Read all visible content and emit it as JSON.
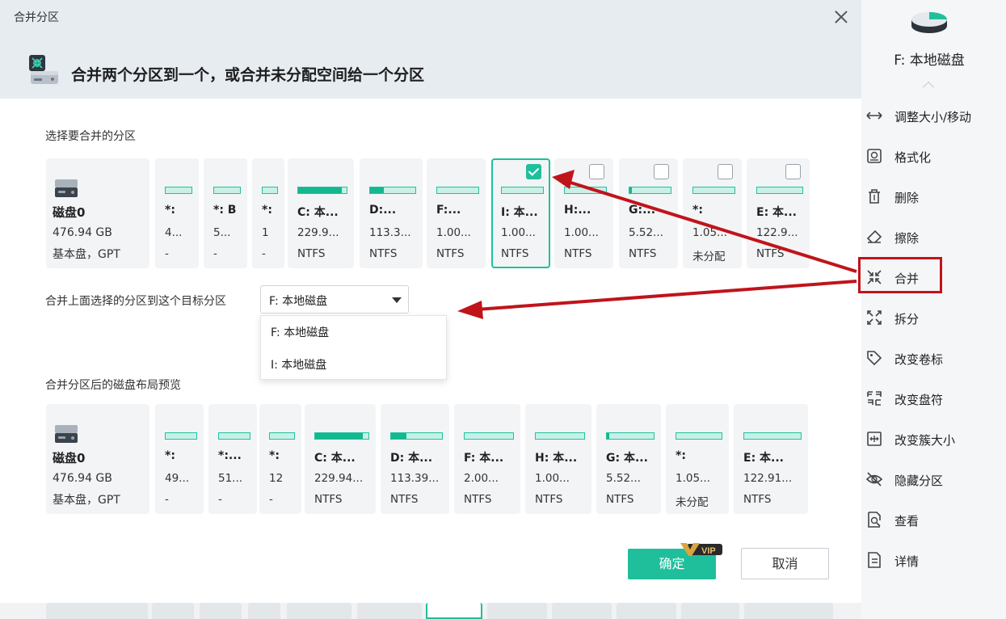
{
  "dialog": {
    "title": "合并分区",
    "heading": "合并两个分区到一个，或合并未分配空间给一个分区",
    "select_label": "选择要合并的分区",
    "target_label": "合并上面选择的分区到这个目标分区",
    "preview_label": "合并分区后的磁盘布局预览",
    "ok_label": "确定",
    "cancel_label": "取消",
    "vip_badge": "VIP"
  },
  "target": {
    "selected": "F: 本地磁盘",
    "options": [
      "F: 本地磁盘",
      "I: 本地磁盘"
    ]
  },
  "disk": {
    "name": "磁盘0",
    "size": "476.94  GB",
    "type": "基本盘，GPT"
  },
  "partitions_top": [
    {
      "name": "*:",
      "size": "4...",
      "fs": "-",
      "used": 0,
      "checkbox": false,
      "checked": false
    },
    {
      "name": "*: B",
      "size": "5...",
      "fs": "-",
      "used": 0,
      "checkbox": false,
      "checked": false
    },
    {
      "name": "*:",
      "size": "1",
      "fs": "-",
      "used": 0,
      "checkbox": false,
      "checked": false
    },
    {
      "name": "C: 本...",
      "size": "229.9...",
      "fs": "NTFS",
      "used": 0.9,
      "checkbox": false,
      "checked": false
    },
    {
      "name": "D:...",
      "size": "113.3...",
      "fs": "NTFS",
      "used": 0.3,
      "checkbox": false,
      "checked": false
    },
    {
      "name": "F:...",
      "size": "1.00...",
      "fs": "NTFS",
      "used": 0,
      "checkbox": false,
      "checked": false
    },
    {
      "name": "I: 本...",
      "size": "1.00...",
      "fs": "NTFS",
      "used": 0,
      "checkbox": true,
      "checked": true
    },
    {
      "name": "H:...",
      "size": "1.00...",
      "fs": "NTFS",
      "used": 0,
      "checkbox": true,
      "checked": false
    },
    {
      "name": "G:...",
      "size": "5.52...",
      "fs": "NTFS",
      "used": 0.05,
      "checkbox": true,
      "checked": false
    },
    {
      "name": "*:",
      "size": "1.05...",
      "fs": "未分配",
      "used": 0,
      "checkbox": true,
      "checked": false
    },
    {
      "name": "E: 本...",
      "size": "122.9...",
      "fs": "NTFS",
      "used": 0,
      "checkbox": true,
      "checked": false
    }
  ],
  "partitions_preview": [
    {
      "name": "*:",
      "size": "49...",
      "fs": "-",
      "used": 0
    },
    {
      "name": "*:...",
      "size": "51...",
      "fs": "-",
      "used": 0
    },
    {
      "name": "*:",
      "size": "12",
      "fs": "-",
      "used": 0
    },
    {
      "name": "C: 本...",
      "size": "229.94...",
      "fs": "NTFS",
      "used": 0.9
    },
    {
      "name": "D: 本...",
      "size": "113.39...",
      "fs": "NTFS",
      "used": 0.3
    },
    {
      "name": "F: 本...",
      "size": "2.00...",
      "fs": "NTFS",
      "used": 0
    },
    {
      "name": "H: 本...",
      "size": "1.00...",
      "fs": "NTFS",
      "used": 0
    },
    {
      "name": "G: 本...",
      "size": "5.52...",
      "fs": "NTFS",
      "used": 0.05
    },
    {
      "name": "*:",
      "size": "1.05...",
      "fs": "未分配",
      "used": 0
    },
    {
      "name": "E: 本...",
      "size": "122.91...",
      "fs": "NTFS",
      "used": 0
    }
  ],
  "right_panel": {
    "title": "F: 本地磁盘",
    "items": [
      {
        "label": "调整大小/移动",
        "icon": "resize-move-icon"
      },
      {
        "label": "格式化",
        "icon": "format-icon"
      },
      {
        "label": "删除",
        "icon": "trash-icon"
      },
      {
        "label": "擦除",
        "icon": "eraser-icon"
      },
      {
        "label": "合并",
        "icon": "merge-icon"
      },
      {
        "label": "拆分",
        "icon": "split-icon"
      },
      {
        "label": "改变卷标",
        "icon": "tag-icon"
      },
      {
        "label": "改变盘符",
        "icon": "drive-letter-icon"
      },
      {
        "label": "改变簇大小",
        "icon": "cluster-icon"
      },
      {
        "label": "隐藏分区",
        "icon": "eye-off-icon"
      },
      {
        "label": "查看",
        "icon": "view-icon"
      },
      {
        "label": "详情",
        "icon": "details-icon"
      }
    ]
  },
  "colors": {
    "accent": "#1fbf9c",
    "highlight_red": "#c0141b",
    "panel_bg": "#f4f6f8"
  }
}
